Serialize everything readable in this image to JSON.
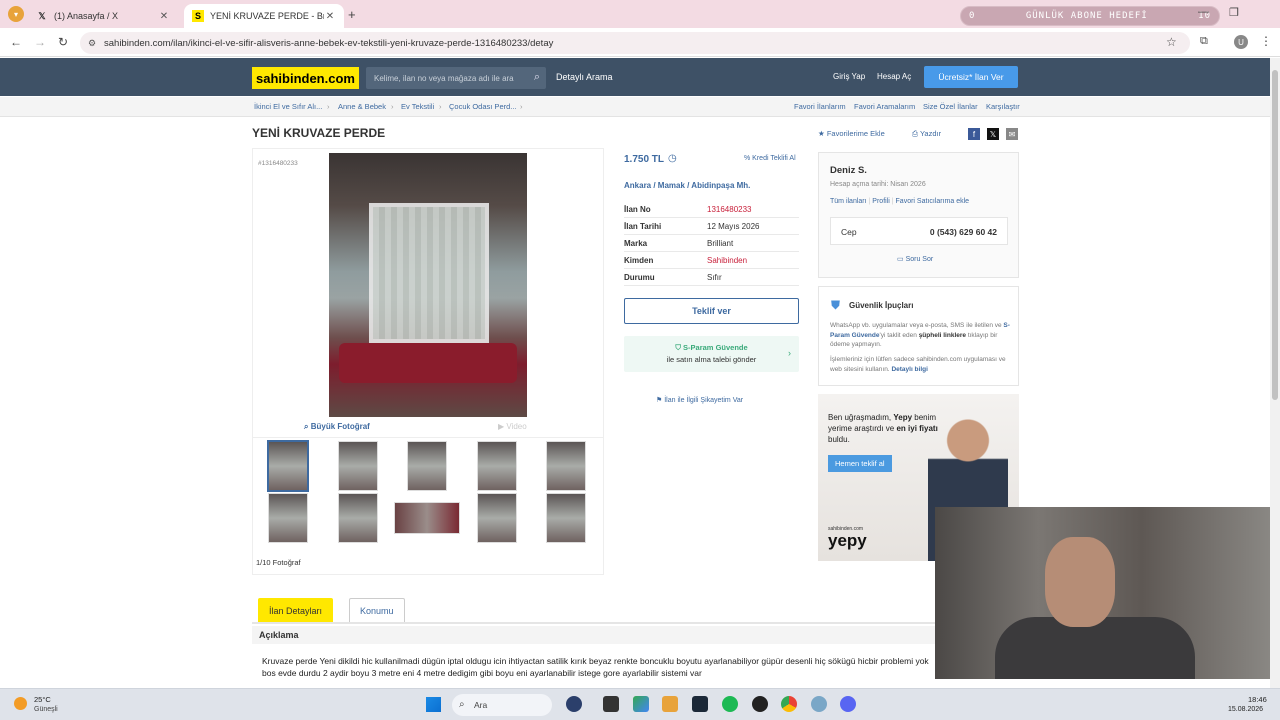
{
  "browser": {
    "tabs": [
      {
        "title": "(1) Anasayfa / X",
        "icon": "x-logo-icon"
      },
      {
        "title": "YENİ KRUVAZE PERDE - Brillian",
        "icon": "sahibinden-s-icon"
      }
    ],
    "url": "sahibinden.com/ilan/ikinci-el-ve-sifir-alisveris-anne-bebek-ev-tekstili-yeni-kruvaze-perde-1316480233/detay",
    "overlay": {
      "left": "0",
      "title": "GÜNLÜK ABONE HEDEFİ",
      "right": "10"
    }
  },
  "site": {
    "logo": "sahibinden.com",
    "search_placeholder": "Kelime, ilan no veya mağaza adı ile ara",
    "detailed_search": "Detaylı Arama",
    "login": "Giriş Yap",
    "register": "Hesap Aç",
    "free_ad": "Ücretsiz* İlan Ver",
    "breadcrumbs": [
      "İkinci El ve Sıfır Alı...",
      "Anne & Bebek",
      "Ev Tekstili",
      "Çocuk Odası Perd..."
    ],
    "right_links": [
      "Favori İlanlarım",
      "Favori Aramalarım",
      "Size Özel İlanlar",
      "Karşılaştır"
    ]
  },
  "listing": {
    "title": "YENİ KRUVAZE PERDE",
    "add_favorite": "Favorilerime Ekle",
    "print": "Yazdır",
    "ad_id": "#1316480233",
    "big_photo": "Büyük Fotoğraf",
    "video": "Video",
    "photo_count": "1/10 Fotoğraf",
    "price": "1.750 TL",
    "credit": "Kredi Teklifi Al",
    "location": "Ankara  /  Mamak  /  Abidinpaşa Mh.",
    "details": [
      {
        "key": "İlan No",
        "value": "1316480233",
        "red": true
      },
      {
        "key": "İlan Tarihi",
        "value": "12 Mayıs 2026",
        "red": false
      },
      {
        "key": "Marka",
        "value": "Brilliant",
        "red": false
      },
      {
        "key": "Kimden",
        "value": "Sahibinden",
        "red": true
      },
      {
        "key": "Durumu",
        "value": "Sıfır",
        "red": false
      }
    ],
    "offer_button": "Teklif ver",
    "sparam_line1": "S-Param Güvende",
    "sparam_line2": "ile satın alma talebi gönder",
    "complain": "İlan ile İlgili Şikayetim Var",
    "tabs": [
      "İlan Detayları",
      "Konumu"
    ],
    "desc_title": "Açıklama",
    "desc_text": "Kruvaze perde Yeni dikildi hic kullanilmadi dügün iptal oldugu icin ihtiyactan satilik kırık beyaz renkte boncuklu boyutu ayarlanabiliyor güpür desenli hiç sökügü hicbir problemi yok bos evde durdu 2 aydir boyu 3 metre eni 4 metre dedigim gibi boyu eni ayarlanabilir istege gore ayarlabilir sistemi var"
  },
  "seller": {
    "name": "Deniz S.",
    "since": "Hesap açma tarihi: Nisan 2026",
    "links": [
      "Tüm ilanları",
      "Profili",
      "Favori Satıcılarıma ekle"
    ],
    "phone_label": "Cep",
    "phone": "0 (543) 629 60 42",
    "ask": "Soru Sor"
  },
  "safety": {
    "title": "Güvenlik İpuçları",
    "p1_a": "WhatsApp vb. uygulamalar veya e-posta, SMS ile iletilen ve ",
    "p1_b": "S-Param Güvende",
    "p1_c": "'yi taklit eden ",
    "p1_d": "şüpheli linklere",
    "p1_e": " tıklayıp bir ödeme yapmayın.",
    "p2": "İşlemleriniz için lütfen sadece sahibinden.com uygulaması ve web sitesini kullanın.",
    "p2_link": "Detaylı bilgi"
  },
  "ad": {
    "text_a": "Ben uğraşmadım, ",
    "text_b": "Yepy",
    "text_c": " benim yerime araştırdı ve ",
    "text_d": "en iyi fiyatı",
    "text_e": " buldu.",
    "button": "Hemen teklif al",
    "brand_small": "sahibinden.com",
    "brand": "yepy"
  },
  "taskbar": {
    "temp": "25°C",
    "weather": "Güneşli",
    "search": "Ara",
    "time": "18:46",
    "date": "15.08.2026"
  }
}
